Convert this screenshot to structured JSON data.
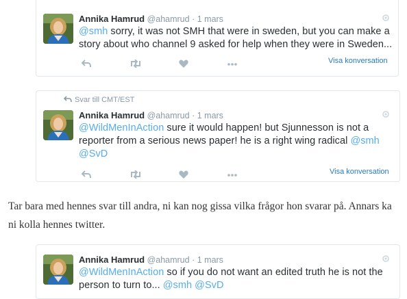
{
  "tweets": [
    {
      "name": "Annika Hamrud",
      "handle": "@ahamrud",
      "separator": "·",
      "time": "1 mars",
      "line1_mention": "@smh",
      "line1_rest": " sorry, it was not SMH that were in sweden, but you can make a",
      "line2": "story about who channel 9 asked for help when they were in Sweden...",
      "view_conversation": "Visa konversation"
    },
    {
      "reply_context": "Svar till CMT/EST",
      "name": "Annika Hamrud",
      "handle": "@ahamrud",
      "separator": "·",
      "time": "1 mars",
      "line1_mention": "@WildMenInAction",
      "line1_rest": " sure it would happen! but Sjunnesson is not a",
      "line2_text": "reporter from a serious news paper! he is a right wing radical ",
      "line2_mention": "@smh",
      "line3_mention": "@SvD",
      "view_conversation": "Visa konversation"
    },
    {
      "name": "Annika Hamrud",
      "handle": "@ahamrud",
      "separator": "·",
      "time": "1 mars",
      "line1_mention": "@WildMenInAction",
      "line1_rest": " so if you do not want an edited truth he is not the",
      "line2_text": "person to turn to... ",
      "line2_mention1": "@smh",
      "line2_mention2": "@SvD"
    }
  ],
  "blog": {
    "line1": "Tar bara med hennes svar till andra, ni kan nog gissa vilka frågor hon svarar på. Annars ka",
    "line2": "ni kolla hennes twitter."
  },
  "icons": {
    "reply": "reply-icon",
    "retweet": "retweet-icon",
    "favorite": "heart-icon",
    "more": "more-icon",
    "corner": "pin-icon",
    "reply_context": "reply-arrow-icon"
  },
  "colors": {
    "mention": "#55acee",
    "link": "#2b7bb9",
    "muted": "#8899a6",
    "border": "#e1e8ed"
  }
}
